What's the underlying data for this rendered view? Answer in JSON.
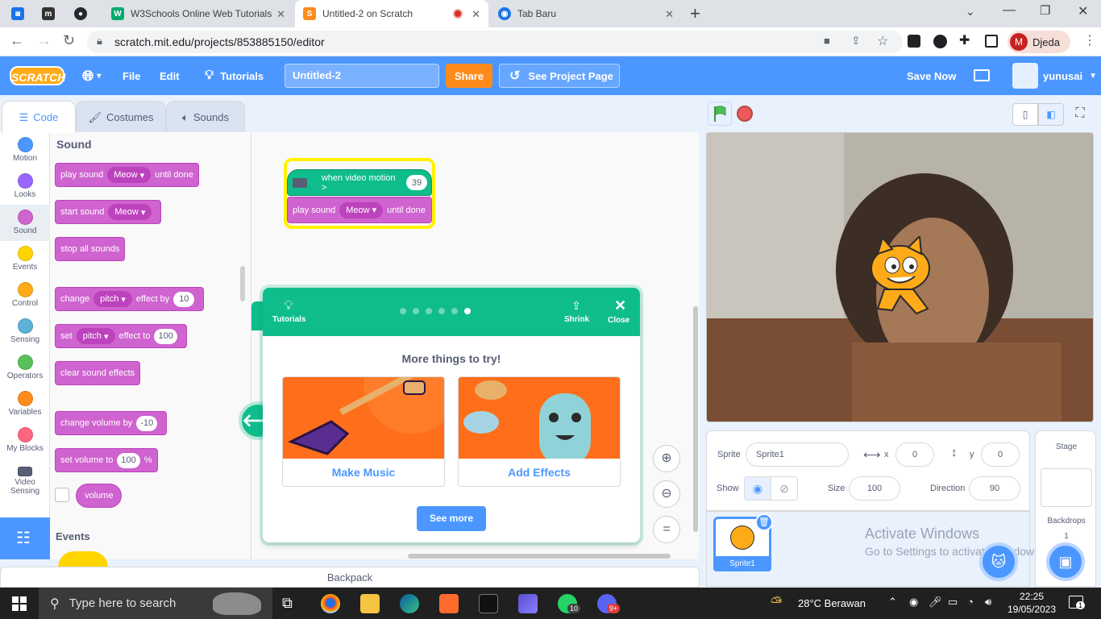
{
  "browser": {
    "tabs": [
      {
        "title": "W3Schools Online Web Tutorials"
      },
      {
        "title": "Untitled-2 on Scratch"
      },
      {
        "title": "Tab Baru"
      }
    ],
    "url": "scratch.mit.edu/projects/853885150/editor",
    "profile_initial": "M",
    "profile_name": "Djeda"
  },
  "menubar": {
    "logo": "SCRATCH",
    "file": "File",
    "edit": "Edit",
    "tutorials": "Tutorials",
    "project_title": "Untitled-2",
    "share": "Share",
    "see_project_page": "See Project Page",
    "save_now": "Save Now",
    "username": "yunusai"
  },
  "editor_tabs": {
    "code": "Code",
    "costumes": "Costumes",
    "sounds": "Sounds"
  },
  "categories": [
    "Motion",
    "Looks",
    "Sound",
    "Events",
    "Control",
    "Sensing",
    "Operators",
    "Variables",
    "My Blocks",
    "Video Sensing"
  ],
  "category_colors": [
    "#4c97ff",
    "#9966ff",
    "#cf63cf",
    "#ffd500",
    "#ffab19",
    "#5cb1d6",
    "#59c059",
    "#ff8c1a",
    "#ff6680",
    "#0fbd8c"
  ],
  "palette": {
    "heading": "Sound",
    "events_heading": "Events",
    "blocks": {
      "play_sound_until_done": {
        "a": "play sound",
        "drop": "Meow",
        "b": "until done"
      },
      "start_sound": {
        "a": "start sound",
        "drop": "Meow"
      },
      "stop_all_sounds": "stop all sounds",
      "change_effect": {
        "a": "change",
        "drop": "pitch",
        "b": "effect by",
        "val": "10"
      },
      "set_effect": {
        "a": "set",
        "drop": "pitch",
        "b": "effect to",
        "val": "100"
      },
      "clear_effects": "clear sound effects",
      "change_volume": {
        "a": "change volume by",
        "val": "-10"
      },
      "set_volume": {
        "a": "set volume to",
        "val": "100",
        "unit": "%"
      },
      "volume_reporter": "volume"
    }
  },
  "script": {
    "hat": {
      "text": "when video motion >",
      "val": "39"
    },
    "play": {
      "a": "play sound",
      "drop": "Meow",
      "b": "until done"
    }
  },
  "modal": {
    "tutorials_label": "Tutorials",
    "shrink": "Shrink",
    "close": "Close",
    "heading": "More things to try!",
    "cards": [
      {
        "label": "Make Music"
      },
      {
        "label": "Add Effects"
      }
    ],
    "see_more": "See more",
    "step_count": 6,
    "active_step": 6
  },
  "backpack": "Backpack",
  "sprite_info": {
    "sprite_label": "Sprite",
    "sprite_name": "Sprite1",
    "x_label": "x",
    "x": "0",
    "y_label": "y",
    "y": "0",
    "show_label": "Show",
    "size_label": "Size",
    "size": "100",
    "direction_label": "Direction",
    "direction": "90"
  },
  "sprite_list": {
    "sprites": [
      {
        "name": "Sprite1"
      }
    ]
  },
  "watermark": {
    "line1": "Activate Windows",
    "line2": "Go to Settings to activate Windows."
  },
  "stage_panel": {
    "title": "Stage",
    "backdrops_label": "Backdrops",
    "backdrops_count": "1"
  },
  "taskbar": {
    "search_placeholder": "Type here to search",
    "weather": "28°C Berawan",
    "time": "22:25",
    "date": "19/05/2023",
    "whatsapp_badge": "10",
    "discord_badge": "9+",
    "notification_count": "1"
  }
}
